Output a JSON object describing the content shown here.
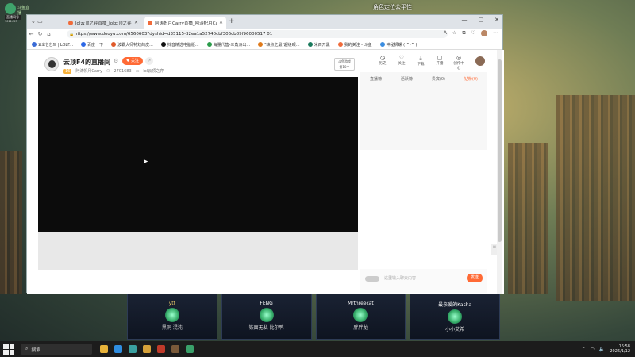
{
  "desktop": {
    "logo_text": "斗鱼直播",
    "logo_sub": "直播间号",
    "logo_id": "7011453",
    "center_title": "角色定位公平性"
  },
  "browser": {
    "tabs": [
      {
        "label": "lol云顶之弈直播_lol云顶之弈直播",
        "active": false
      },
      {
        "label": "阿涛帜月Carry直播_阿涛帜月Carry",
        "active": true
      }
    ],
    "url": "https://www.douyu.com/6560603?dyshid=d35115-32ea1a52740cbf306cb89f96000517 01",
    "favorites": [
      {
        "label": "효효한한드 | LOLF...",
        "color": "#3a6bd6"
      },
      {
        "label": "百度一下",
        "color": "#2d68e6"
      },
      {
        "label": "波霸大师特效的皮...",
        "color": "#e05a2a"
      },
      {
        "label": "抖音精选电脑版...",
        "color": "#111111"
      },
      {
        "label": "海量代售-三角洲出...",
        "color": "#2a9c4a"
      },
      {
        "label": "\"缺点之最\"超级眼...",
        "color": "#e07a1a"
      },
      {
        "label": "米西开黑",
        "color": "#1a7a5c"
      },
      {
        "label": "我的关注 - 斗鱼",
        "color": "#f06b3a"
      },
      {
        "label": "神秘狮螺 ( ^-^ )",
        "color": "#3b8de0"
      }
    ]
  },
  "room": {
    "title": "云顶F4的直播间",
    "follow_label": "关注",
    "level": "16",
    "streamer": "阿涛帜月Carry",
    "fans": "2701683",
    "category": "lol云顶之弈",
    "rank_label": "斗鱼游戏",
    "rank_sub": "第10个"
  },
  "side_icons": [
    {
      "icon": "history-icon",
      "glyph": "◷",
      "label": "历史"
    },
    {
      "icon": "heart-icon",
      "glyph": "♡",
      "label": "关注"
    },
    {
      "icon": "download-icon",
      "glyph": "⤓",
      "label": "下载"
    },
    {
      "icon": "broadcast-icon",
      "glyph": "▢",
      "label": "开播"
    },
    {
      "icon": "bulb-icon",
      "glyph": "◎",
      "label": "创作中心"
    }
  ],
  "side_tabs": [
    {
      "label": "直播榜",
      "active": false
    },
    {
      "label": "活跃榜",
      "active": false
    },
    {
      "label": "贵宾(0)",
      "active": false
    },
    {
      "label": "钻粉(0)",
      "active": true
    }
  ],
  "chat": {
    "placeholder": "这里输入聊天内容",
    "send_label": "发送"
  },
  "players": [
    {
      "name": "ytt",
      "gold": true,
      "trait": "黑洞 混沌"
    },
    {
      "name": "FENG",
      "gold": false,
      "trait": "铁面无私 比尔鸭"
    },
    {
      "name": "Mrthreecat",
      "gold": false,
      "trait": "胖胖龙"
    },
    {
      "name": "最亲爱的Kasha",
      "gold": false,
      "trait": "小小艾希"
    }
  ],
  "taskbar": {
    "search_label": "搜索",
    "time": "16:58",
    "date": "2026/1/12"
  }
}
